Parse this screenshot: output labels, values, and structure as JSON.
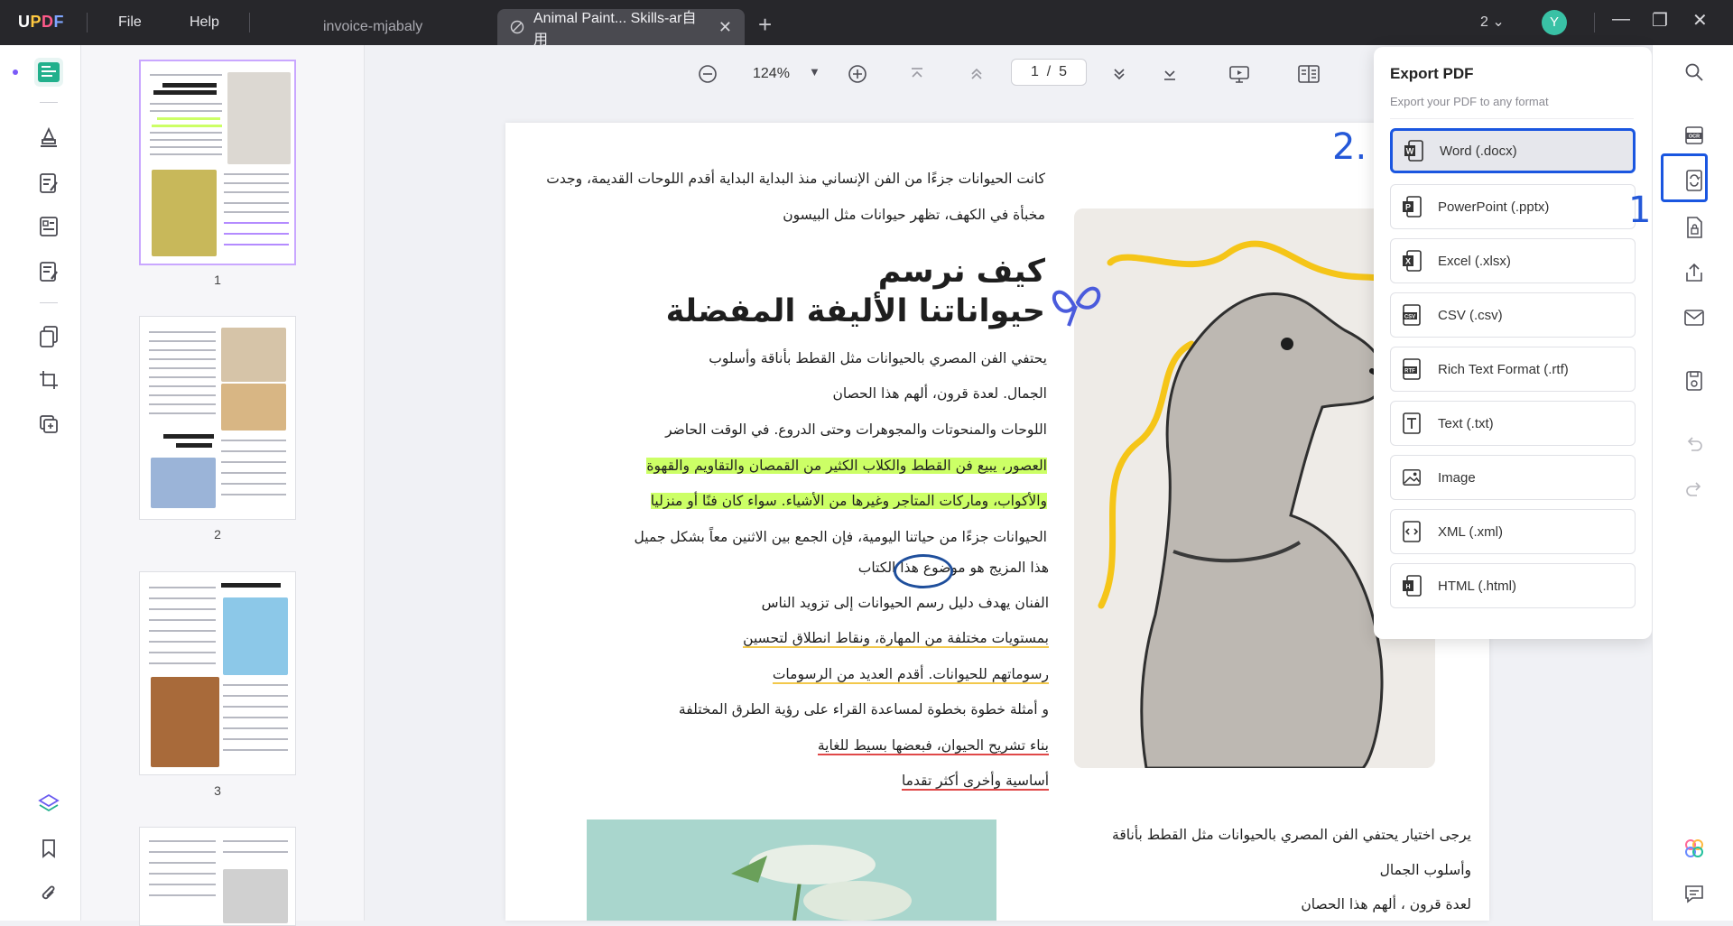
{
  "titlebar": {
    "logo": "UPDF",
    "menu_file": "File",
    "menu_help": "Help",
    "tab_inactive": "invoice-mjabaly",
    "tab_active": "Animal Paint... Skills-ar自用",
    "window_count": "2",
    "avatar_letter": "Y"
  },
  "toolbar": {
    "zoom": "124%",
    "page_current": "1",
    "page_sep": "/",
    "page_total": "5"
  },
  "thumbnails": {
    "pages": [
      "1",
      "2",
      "3"
    ]
  },
  "document": {
    "intro_line1": "كانت الحيوانات جزءًا من الفن الإنساني منذ البداية البداية أقدم اللوحات القديمة، وجدت",
    "intro_line2": "مخبأة في الكهف، تظهر حيوانات مثل البيسون",
    "title_line1": "كيف نرسم",
    "title_line2": "حيواناتنا الأليفة المفضلة",
    "p1": "يحتفي الفن المصري بالحيوانات مثل القطط بأناقة وأسلوب",
    "p2": "الجمال. لعدة قرون، ألهم هذا الحصان",
    "p3": "اللوحات والمنحوتات والمجوهرات وحتى الدروع. في الوقت الحاضر",
    "p4": "العصور، يبيع فن القطط والكلاب الكثير من القمصان والتقاويم والقهوة",
    "p5": "والأكواب، وماركات المتاجر وغيرها من الأشياء. سواء كان فنًا أو منزليا",
    "p6": "الحيوانات جزءًا من حياتنا اليومية، فإن الجمع بين الاثنين معاً بشكل جميل",
    "p7": "هذا المزيج هو موضوع هذا الكتاب",
    "p8": "الفنان يهدف دليل رسم الحيوانات إلى تزويد الناس",
    "p9": "بمستويات مختلفة من المهارة، ونقاط انطلاق لتحسين",
    "p10": "رسوماتهم للحيوانات. أقدم العديد من الرسومات",
    "p11": "و أمثلة خطوة بخطوة لمساعدة القراء على رؤية الطرق المختلفة",
    "p12": "بناء تشريح الحيوان، فبعضها بسيط للغاية",
    "p13": "أساسية وأخرى أكثر تقدما",
    "r1": "يرجى اختيار يحتفي الفن المصري بالحيوانات مثل القطط بأناقة",
    "r2": "وأسلوب الجمال",
    "r3": "لعدة قرون ، ألهم هذا الحصان"
  },
  "export": {
    "title": "Export PDF",
    "subtitle": "Export your PDF to any format",
    "options": [
      {
        "label": "Word (.docx)",
        "icon": "word-icon"
      },
      {
        "label": "PowerPoint (.pptx)",
        "icon": "powerpoint-icon"
      },
      {
        "label": "Excel (.xlsx)",
        "icon": "excel-icon"
      },
      {
        "label": "CSV (.csv)",
        "icon": "csv-icon"
      },
      {
        "label": "Rich Text Format (.rtf)",
        "icon": "rtf-icon"
      },
      {
        "label": "Text (.txt)",
        "icon": "text-icon"
      },
      {
        "label": "Image",
        "icon": "image-icon"
      },
      {
        "label": "XML (.xml)",
        "icon": "xml-icon"
      },
      {
        "label": "HTML (.html)",
        "icon": "html-icon"
      }
    ]
  },
  "annotations": {
    "step1": "1.",
    "step2": "2."
  },
  "colors": {
    "accent_blue": "#1a56e0",
    "highlight_green": "#ccff66",
    "underline_yellow": "#f2c84b",
    "underline_red": "#e04848"
  }
}
